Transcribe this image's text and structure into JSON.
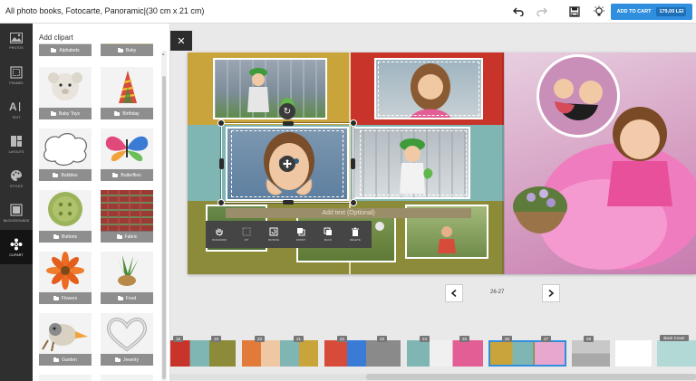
{
  "header": {
    "title": "All photo books, Fotocarte, Panoramic|(30 cm x 21 cm)",
    "cart_label": "ADD TO CART",
    "price": "179,00 LEI",
    "icons": [
      "undo-icon",
      "redo-icon",
      "save-icon",
      "lightbulb-icon"
    ]
  },
  "rail": {
    "items": [
      {
        "label": "PHOTOS",
        "icon": "image-icon"
      },
      {
        "label": "FRAMES",
        "icon": "frame-icon"
      },
      {
        "label": "TEXT",
        "icon": "text-icon"
      },
      {
        "label": "LAYOUTS",
        "icon": "layout-icon"
      },
      {
        "label": "STYLES",
        "icon": "palette-icon"
      },
      {
        "label": "BACKGROUNDS",
        "icon": "background-icon"
      },
      {
        "label": "CLIPART",
        "icon": "clipart-icon"
      }
    ],
    "active": "CLIPART"
  },
  "panel": {
    "title": "Add clipart",
    "items": [
      {
        "label": "Alphabets"
      },
      {
        "label": "Baby"
      },
      {
        "label": "Baby Toys"
      },
      {
        "label": "Birthday"
      },
      {
        "label": "Bubbles"
      },
      {
        "label": "Butterflies"
      },
      {
        "label": "Buttons"
      },
      {
        "label": "Fabric"
      },
      {
        "label": "Flowers"
      },
      {
        "label": "Food"
      },
      {
        "label": "Garden"
      },
      {
        "label": "Jewelry"
      }
    ]
  },
  "canvas": {
    "text_placeholder": "Add text (Optional)",
    "toolbar": [
      "PAN/ZOOM",
      "FIT",
      "ROTATE",
      "FRONT",
      "BACK",
      "DELETE"
    ],
    "page_range": "26-27"
  },
  "thumbnails": [
    {
      "pages": [
        "18",
        "19"
      ]
    },
    {
      "pages": [
        "20",
        "21"
      ]
    },
    {
      "pages": [
        "22",
        "23"
      ]
    },
    {
      "pages": [
        "24",
        "25"
      ]
    },
    {
      "pages": [
        "26",
        "27"
      ]
    },
    {
      "pages": [
        "28"
      ]
    },
    {
      "pages": [
        "Back Cover"
      ]
    }
  ],
  "colors": {
    "accent": "#2f8ede",
    "rail": "#2f2f2f",
    "selection": "#2f8ede"
  }
}
